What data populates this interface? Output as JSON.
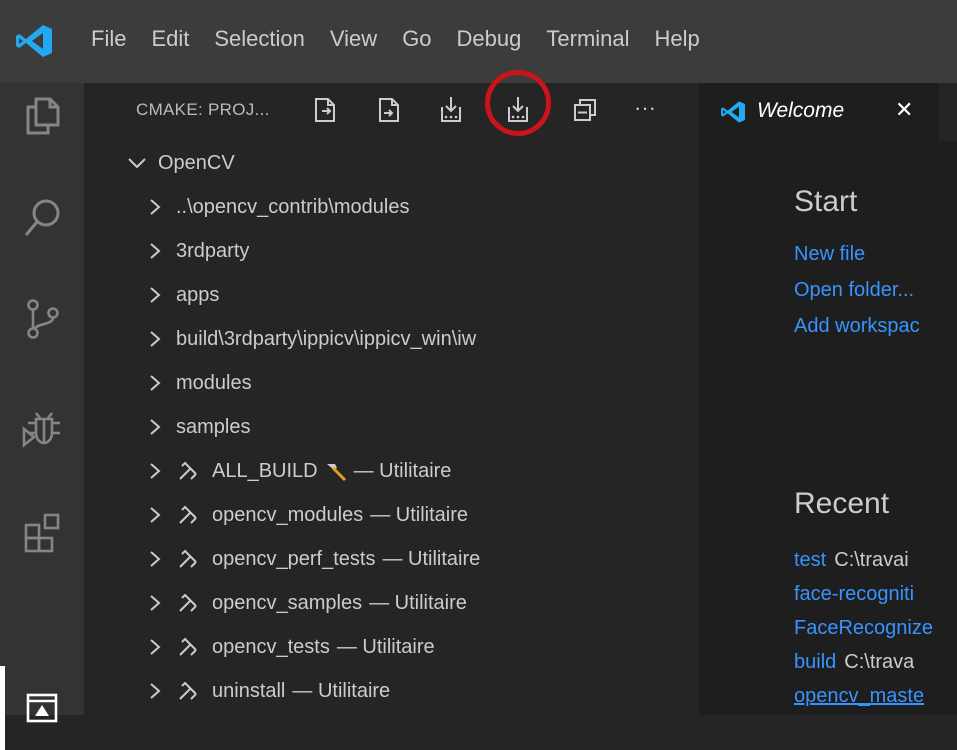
{
  "titlebar": {
    "menu": [
      "File",
      "Edit",
      "Selection",
      "View",
      "Go",
      "Debug",
      "Terminal",
      "Help"
    ]
  },
  "activitybar": {
    "icons": [
      "explorer-icon",
      "search-icon",
      "source-control-icon",
      "debug-icon",
      "extensions-icon",
      "cmake-icon"
    ]
  },
  "sidebar": {
    "title": "CMAKE: PROJ...",
    "toolbar_icons": [
      "configure-icon",
      "build-icon",
      "build-target-icon",
      "build-all-icon",
      "collapse-all-icon",
      "more-actions-icon"
    ],
    "more_label": "···",
    "tree": {
      "root": "OpenCV",
      "folders": [
        "..\\opencv_contrib\\modules",
        "3rdparty",
        "apps",
        "build\\3rdparty\\ippicv\\ippicv_win\\iw",
        "modules",
        "samples"
      ],
      "targets": [
        {
          "name": "ALL_BUILD",
          "suffix": "— Utilitaire",
          "default": true
        },
        {
          "name": "opencv_modules",
          "suffix": "— Utilitaire",
          "default": false
        },
        {
          "name": "opencv_perf_tests",
          "suffix": "— Utilitaire",
          "default": false
        },
        {
          "name": "opencv_samples",
          "suffix": "— Utilitaire",
          "default": false
        },
        {
          "name": "opencv_tests",
          "suffix": "— Utilitaire",
          "default": false
        },
        {
          "name": "uninstall",
          "suffix": "— Utilitaire",
          "default": false
        }
      ]
    }
  },
  "editor": {
    "tab_label": "Welcome",
    "close_label": "✕",
    "start_heading": "Start",
    "start_links": [
      "New file",
      "Open folder...",
      "Add workspac"
    ],
    "recent_heading": "Recent",
    "recent": [
      {
        "name": "test",
        "path": "C:\\travai"
      },
      {
        "name": "face-recogniti",
        "path": ""
      },
      {
        "name": "FaceRecognize",
        "path": ""
      },
      {
        "name": "build",
        "path": "C:\\trava"
      },
      {
        "name": "opencv_maste",
        "path": ""
      }
    ]
  },
  "colors": {
    "accent_link": "#3794ff",
    "highlight_ring": "#c8141a",
    "vscode_blue": "#23a9f2"
  }
}
